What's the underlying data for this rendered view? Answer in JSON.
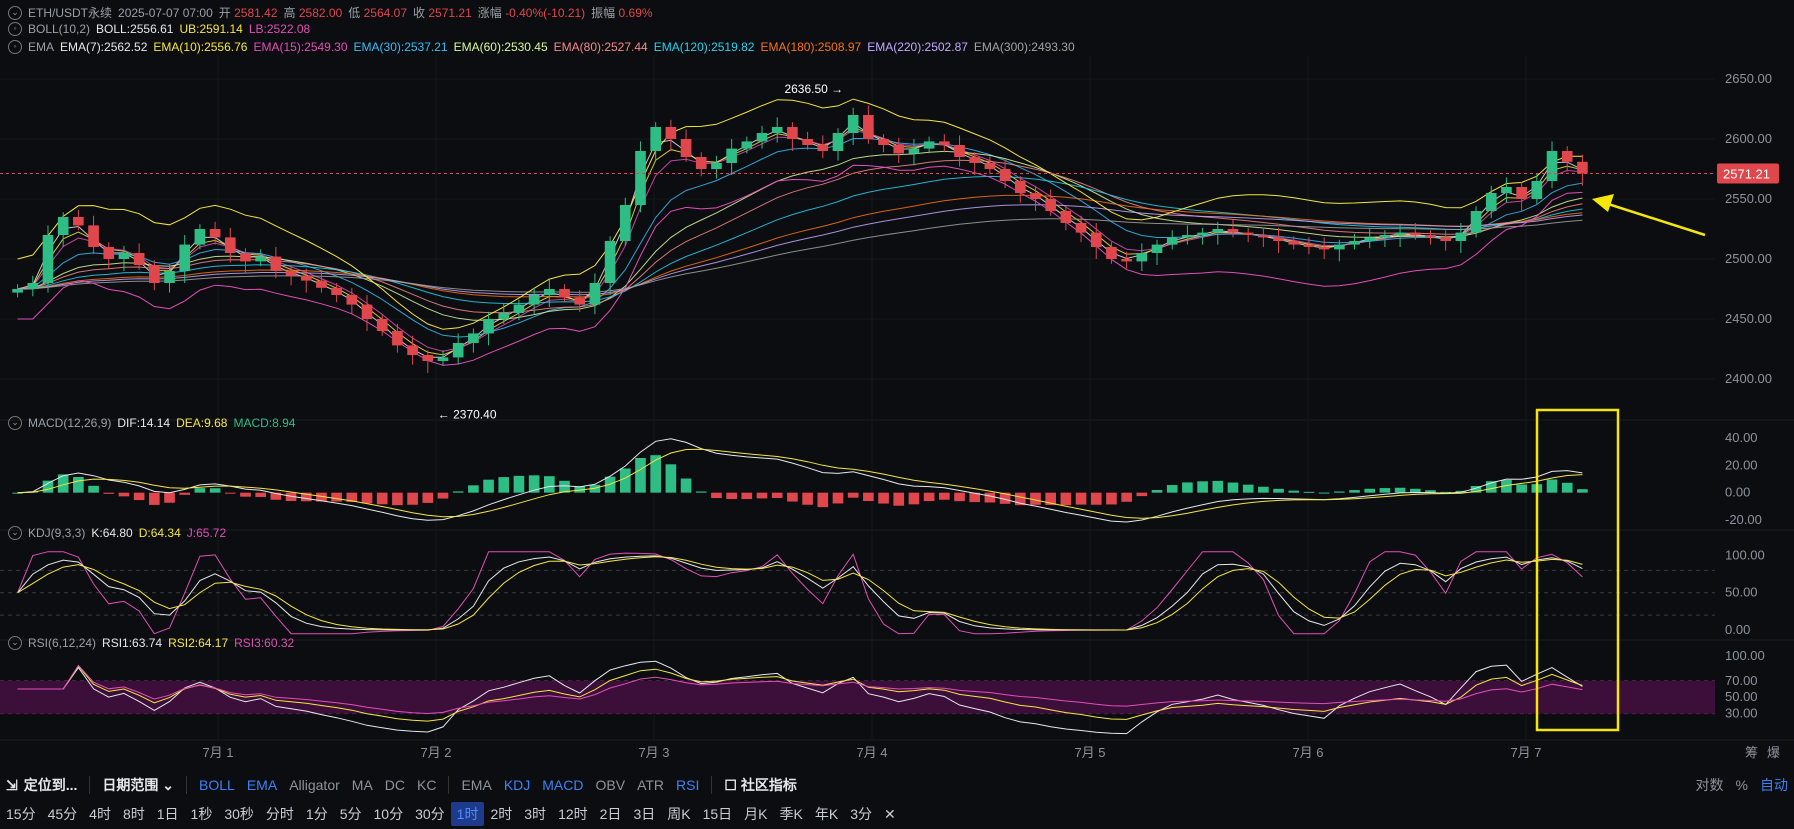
{
  "header": {
    "symbol": "ETH/USDT永续",
    "datetime": "2025-07-07 07:00",
    "open_label": "开",
    "open": "2581.42",
    "high_label": "高",
    "high": "2582.00",
    "low_label": "低",
    "low": "2564.07",
    "close_label": "收",
    "close": "2571.21",
    "change_label": "涨幅",
    "change": "-0.40%(-10.21)",
    "amp_label": "振幅",
    "amp": "0.69%"
  },
  "boll": {
    "name": "BOLL(10,2)",
    "mid": "BOLL:2556.61",
    "ub": "UB:2591.14",
    "lb": "LB:2522.08"
  },
  "ema": {
    "name": "EMA",
    "items": [
      {
        "text": "EMA(7):2562.52",
        "color": "#e6e8eb"
      },
      {
        "text": "EMA(10):2556.76",
        "color": "#f5e642"
      },
      {
        "text": "EMA(15):2549.30",
        "color": "#e04fb7"
      },
      {
        "text": "EMA(30):2537.21",
        "color": "#38bdf8"
      },
      {
        "text": "EMA(60):2530.45",
        "color": "#d9f99d"
      },
      {
        "text": "EMA(80):2527.44",
        "color": "#f48a8a"
      },
      {
        "text": "EMA(120):2519.82",
        "color": "#22d3ee"
      },
      {
        "text": "EMA(180):2508.97",
        "color": "#f97316"
      },
      {
        "text": "EMA(220):2502.87",
        "color": "#c4a8ff"
      },
      {
        "text": "EMA(300):2493.30",
        "color": "#a3a3a3"
      }
    ]
  },
  "macd_legend": {
    "name": "MACD(12,26,9)",
    "dif": "DIF:14.14",
    "dea": "DEA:9.68",
    "macd": "MACD:8.94"
  },
  "kdj_legend": {
    "name": "KDJ(9,3,3)",
    "k": "K:64.80",
    "d": "D:64.34",
    "j": "J:65.72"
  },
  "rsi_legend": {
    "name": "RSI(6,12,24)",
    "r1": "RSI1:63.74",
    "r2": "RSI2:64.17",
    "r3": "RSI3:60.32"
  },
  "annotations": {
    "high_label": "2636.50",
    "low_label": "2370.40",
    "last_price": "2571.21"
  },
  "price_axis": {
    "ticks": [
      "2650.00",
      "2600.00",
      "2550.00",
      "2500.00",
      "2450.00",
      "2400.00"
    ]
  },
  "macd_axis": {
    "ticks": [
      "40.00",
      "20.00",
      "0.00",
      "-20.00"
    ]
  },
  "kdj_axis": {
    "ticks": [
      "100.00",
      "50.00",
      "0.00"
    ]
  },
  "rsi_axis": {
    "ticks": [
      "100.00",
      "70.00",
      "50.00",
      "30.00"
    ]
  },
  "x_axis": {
    "labels": [
      "7月 1",
      "7月 2",
      "7月 3",
      "7月 4",
      "7月 5",
      "7月 6",
      "7月 7"
    ]
  },
  "corner": {
    "chip": "筹",
    "boom": "爆"
  },
  "toolbar1": {
    "locate": "定位到...",
    "daterange": "日期范围",
    "main_ind": [
      "BOLL",
      "EMA",
      "Alligator",
      "MA",
      "DC",
      "KC"
    ],
    "sub_ind": [
      "EMA",
      "KDJ",
      "MACD",
      "OBV",
      "ATR",
      "RSI"
    ],
    "community": "社区指标",
    "log": "对数",
    "pct": "%",
    "auto": "自动"
  },
  "timeframes": {
    "items": [
      "15分",
      "45分",
      "4时",
      "8时",
      "1日",
      "1秒",
      "30秒",
      "分时",
      "1分",
      "5分",
      "10分",
      "30分",
      "1时",
      "2时",
      "3时",
      "12时",
      "2日",
      "3日",
      "周K",
      "15日",
      "月K",
      "季K",
      "年K",
      "3分"
    ],
    "active": "1时",
    "close": "✕"
  },
  "colors": {
    "up": "#2ebd85",
    "down": "#e0474c",
    "bg": "#0c0d10",
    "grid": "#1b1d22",
    "highlight": "#f5e60a",
    "rsi_band": "#3b0f3a"
  },
  "chart_data": {
    "type": "candlestick",
    "timeframe": "1时",
    "ylim": [
      2370,
      2670
    ],
    "last_close": 2571.21,
    "high": 2636.5,
    "low": 2370.4,
    "closes": [
      2475,
      2480,
      2520,
      2535,
      2528,
      2510,
      2500,
      2505,
      2495,
      2480,
      2490,
      2512,
      2525,
      2518,
      2505,
      2498,
      2502,
      2490,
      2486,
      2482,
      2476,
      2470,
      2462,
      2450,
      2440,
      2428,
      2420,
      2415,
      2418,
      2430,
      2438,
      2450,
      2455,
      2462,
      2470,
      2475,
      2468,
      2462,
      2480,
      2515,
      2545,
      2590,
      2610,
      2600,
      2585,
      2575,
      2580,
      2592,
      2598,
      2605,
      2610,
      2600,
      2595,
      2590,
      2605,
      2620,
      2600,
      2595,
      2588,
      2592,
      2598,
      2595,
      2585,
      2580,
      2575,
      2565,
      2555,
      2550,
      2540,
      2530,
      2522,
      2510,
      2500,
      2498,
      2505,
      2512,
      2518,
      2520,
      2522,
      2525,
      2522,
      2520,
      2518,
      2515,
      2512,
      2510,
      2508,
      2512,
      2515,
      2518,
      2520,
      2522,
      2520,
      2518,
      2515,
      2522,
      2540,
      2555,
      2560,
      2550,
      2565,
      2590,
      2581,
      2571.21
    ]
  }
}
